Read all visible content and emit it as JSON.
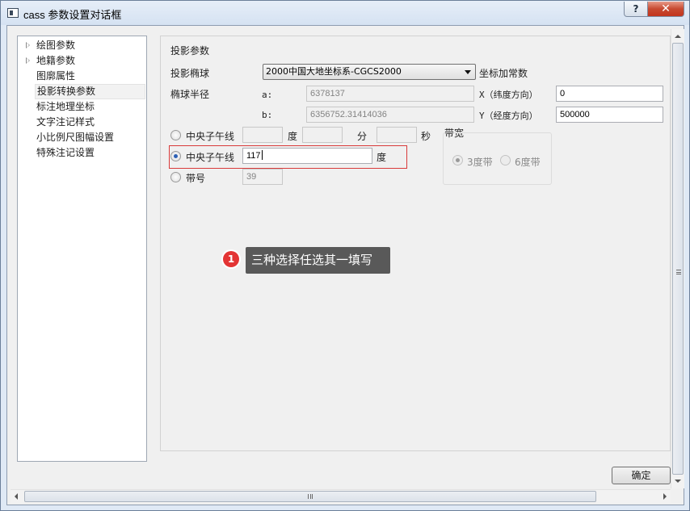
{
  "window": {
    "title": "cass 参数设置对话框",
    "help_label": "?",
    "close_label": "✕"
  },
  "tree": {
    "items": [
      {
        "label": "绘图参数",
        "expandable": true
      },
      {
        "label": "地籍参数",
        "expandable": true
      },
      {
        "label": "图廓属性",
        "expandable": false
      },
      {
        "label": "投影转换参数",
        "expandable": false,
        "selected": true
      },
      {
        "label": "标注地理坐标",
        "expandable": false
      },
      {
        "label": "文字注记样式",
        "expandable": false
      },
      {
        "label": "小比例尺图幅设置",
        "expandable": false
      },
      {
        "label": "特殊注记设置",
        "expandable": false
      }
    ]
  },
  "panel": {
    "section_title": "投影参数",
    "ellipsoid_label": "投影椭球",
    "ellipsoid_value": "2000中国大地坐标系-CGCS2000",
    "coord_const_label": "坐标加常数",
    "radius_label": "椭球半径",
    "a_label": "a:",
    "a_value": "6378137",
    "b_label": "b:",
    "b_value": "6356752.31414036",
    "x_label": "X（纬度方向）",
    "x_value": "0",
    "y_label": "Y（经度方向）",
    "y_value": "500000",
    "option1_label": "中央子午线",
    "deg_label": "度",
    "min_label": "分",
    "sec_label": "秒",
    "option2_label": "中央子午线",
    "option2_value": "117",
    "option2_unit": "度",
    "option3_label": "带号",
    "option3_value": "39",
    "band_group_title": "带宽",
    "band3_label": "3度带",
    "band6_label": "6度带",
    "selected_option": 2
  },
  "annotation": {
    "badge": "1",
    "text": "三种选择任选其一填写",
    "badge_color": "#e33434",
    "highlight_color": "#d93a3a"
  },
  "footer": {
    "ok_label": "确定"
  }
}
